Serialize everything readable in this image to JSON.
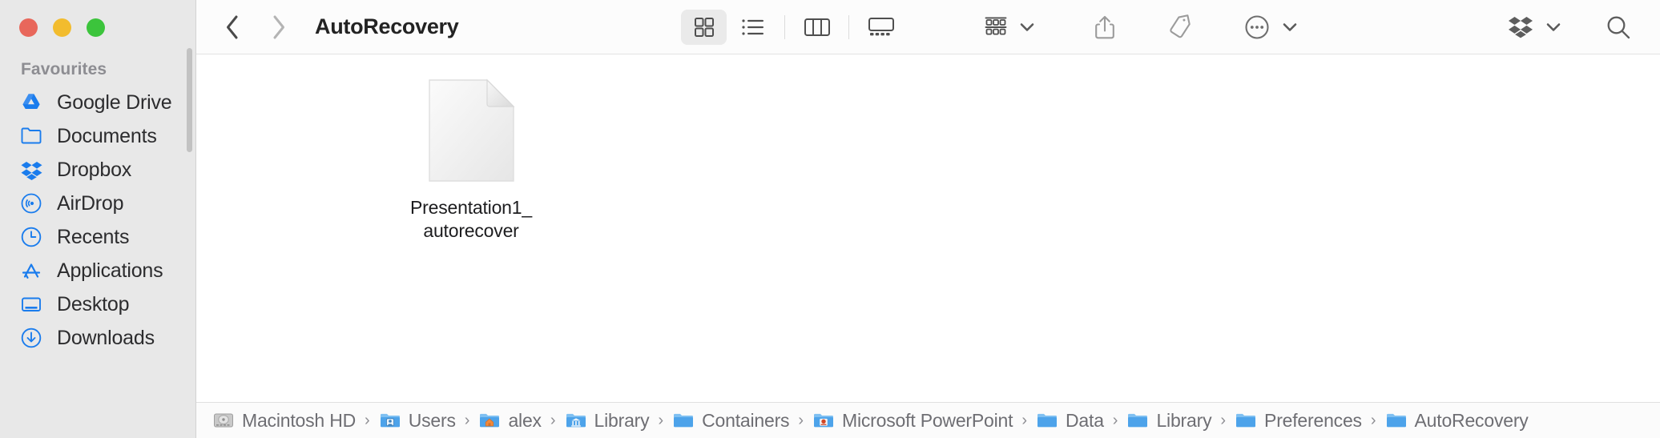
{
  "window": {
    "traffic_lights": [
      {
        "name": "close",
        "color": "#e8675b"
      },
      {
        "name": "minimize",
        "color": "#f2bc2e"
      },
      {
        "name": "zoom",
        "color": "#3cc43c"
      }
    ]
  },
  "sidebar": {
    "section_title": "Favourites",
    "items": [
      {
        "label": "Google Drive",
        "icon": "google-drive-icon"
      },
      {
        "label": "Documents",
        "icon": "folder-icon"
      },
      {
        "label": "Dropbox",
        "icon": "dropbox-icon"
      },
      {
        "label": "AirDrop",
        "icon": "airdrop-icon"
      },
      {
        "label": "Recents",
        "icon": "clock-icon"
      },
      {
        "label": "Applications",
        "icon": "applications-icon"
      },
      {
        "label": "Desktop",
        "icon": "desktop-icon"
      },
      {
        "label": "Downloads",
        "icon": "downloads-icon"
      }
    ]
  },
  "toolbar": {
    "back_label": "Back",
    "forward_label": "Forward",
    "title": "AutoRecovery",
    "view_modes": [
      {
        "label": "Icon View",
        "icon": "grid-icon",
        "active": true
      },
      {
        "label": "List View",
        "icon": "list-icon",
        "active": false
      },
      {
        "label": "Column View",
        "icon": "columns-icon",
        "active": false
      },
      {
        "label": "Gallery View",
        "icon": "gallery-icon",
        "active": false
      }
    ],
    "actions": [
      {
        "label": "Group",
        "icon": "group-icon",
        "has_chevron": true
      },
      {
        "label": "Share",
        "icon": "share-icon",
        "has_chevron": false
      },
      {
        "label": "Tags",
        "icon": "tag-icon",
        "has_chevron": false
      },
      {
        "label": "More",
        "icon": "ellipsis-circle-icon",
        "has_chevron": true
      }
    ],
    "right_actions": [
      {
        "label": "Dropbox",
        "icon": "dropbox-icon",
        "has_chevron": true
      },
      {
        "label": "Search",
        "icon": "search-icon",
        "has_chevron": false
      }
    ]
  },
  "content": {
    "files": [
      {
        "name": "Presentation1_autorecover",
        "icon": "generic-document-icon"
      }
    ]
  },
  "pathbar": {
    "crumbs": [
      {
        "label": "Macintosh HD",
        "icon": "hard-drive-icon"
      },
      {
        "label": "Users",
        "icon": "users-folder-icon"
      },
      {
        "label": "alex",
        "icon": "home-folder-icon"
      },
      {
        "label": "Library",
        "icon": "library-folder-icon"
      },
      {
        "label": "Containers",
        "icon": "folder-icon"
      },
      {
        "label": "Microsoft PowerPoint",
        "icon": "powerpoint-folder-icon"
      },
      {
        "label": "Data",
        "icon": "folder-icon"
      },
      {
        "label": "Library",
        "icon": "folder-icon"
      },
      {
        "label": "Preferences",
        "icon": "folder-icon"
      },
      {
        "label": "AutoRecovery",
        "icon": "folder-icon"
      }
    ],
    "separator": "›"
  },
  "colors": {
    "accent_blue": "#1a7ced",
    "sidebar_bg": "#e8e8e8",
    "toolbar_bg": "#fcfcfc",
    "text_primary": "#2c2c2e",
    "text_secondary": "#6e6e73"
  }
}
